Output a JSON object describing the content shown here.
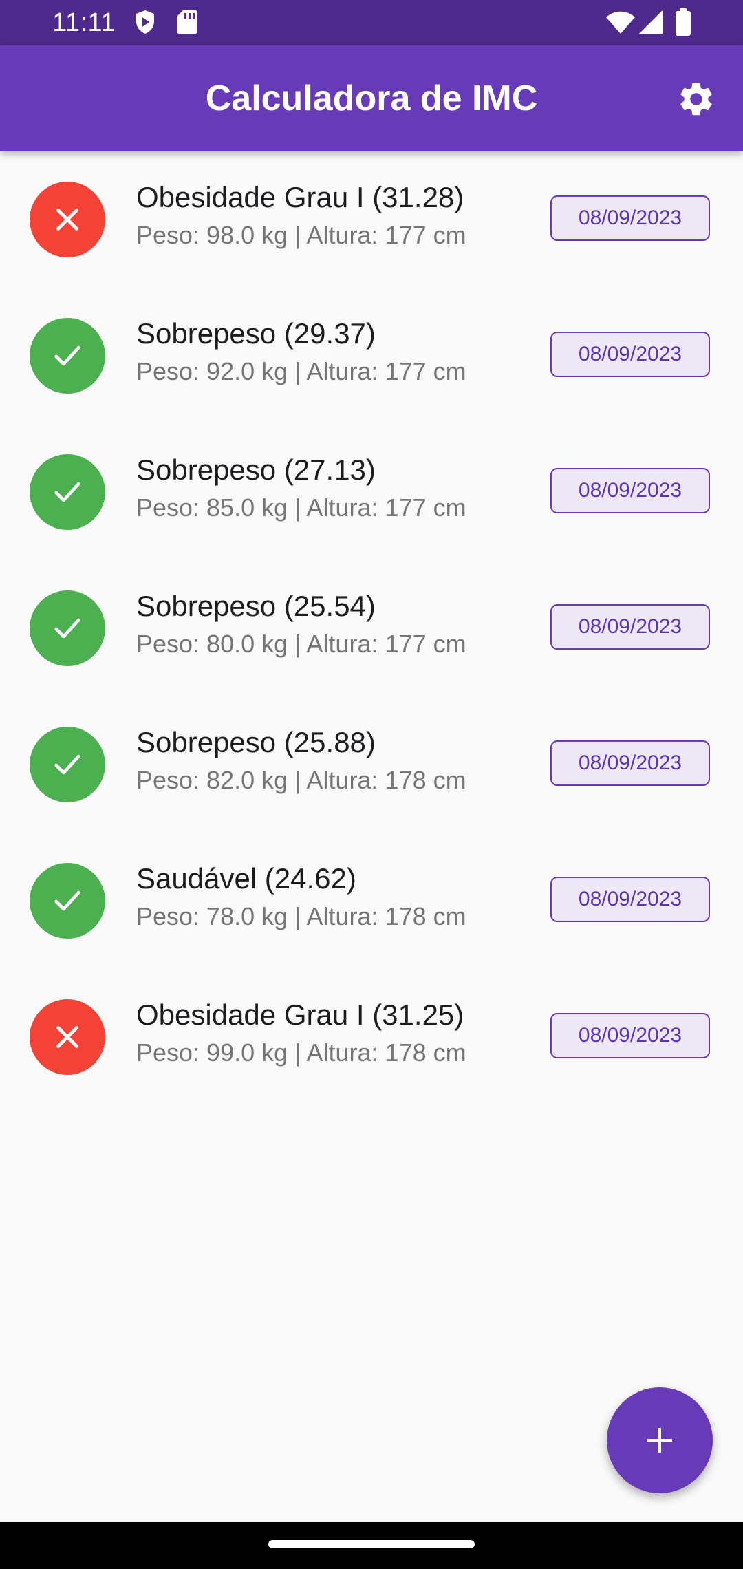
{
  "status_bar": {
    "time": "11:11",
    "icons": [
      "play-protect-icon",
      "sd-card-icon",
      "wifi-icon",
      "signal-icon",
      "battery-icon"
    ]
  },
  "app_bar": {
    "title": "Calculadora de IMC",
    "settings_icon": "gear-icon"
  },
  "colors": {
    "primary": "#673AB7",
    "status_bar": "#4E2A8C",
    "ok": "#4CAF50",
    "bad": "#F44336"
  },
  "records": [
    {
      "status": "bad",
      "status_icon": "close-icon",
      "title": "Obesidade Grau I (31.28)",
      "subtitle": "Peso: 98.0 kg | Altura: 177 cm",
      "date": "08/09/2023"
    },
    {
      "status": "ok",
      "status_icon": "check-icon",
      "title": "Sobrepeso (29.37)",
      "subtitle": "Peso: 92.0 kg | Altura: 177 cm",
      "date": "08/09/2023"
    },
    {
      "status": "ok",
      "status_icon": "check-icon",
      "title": "Sobrepeso (27.13)",
      "subtitle": "Peso: 85.0 kg | Altura: 177 cm",
      "date": "08/09/2023"
    },
    {
      "status": "ok",
      "status_icon": "check-icon",
      "title": "Sobrepeso (25.54)",
      "subtitle": "Peso: 80.0 kg | Altura: 177 cm",
      "date": "08/09/2023"
    },
    {
      "status": "ok",
      "status_icon": "check-icon",
      "title": "Sobrepeso (25.88)",
      "subtitle": "Peso: 82.0 kg | Altura: 178 cm",
      "date": "08/09/2023"
    },
    {
      "status": "ok",
      "status_icon": "check-icon",
      "title": "Saudável (24.62)",
      "subtitle": "Peso: 78.0 kg | Altura: 178 cm",
      "date": "08/09/2023"
    },
    {
      "status": "bad",
      "status_icon": "close-icon",
      "title": "Obesidade Grau I (31.25)",
      "subtitle": "Peso: 99.0 kg | Altura: 178 cm",
      "date": "08/09/2023"
    }
  ],
  "fab": {
    "icon": "add-icon"
  }
}
